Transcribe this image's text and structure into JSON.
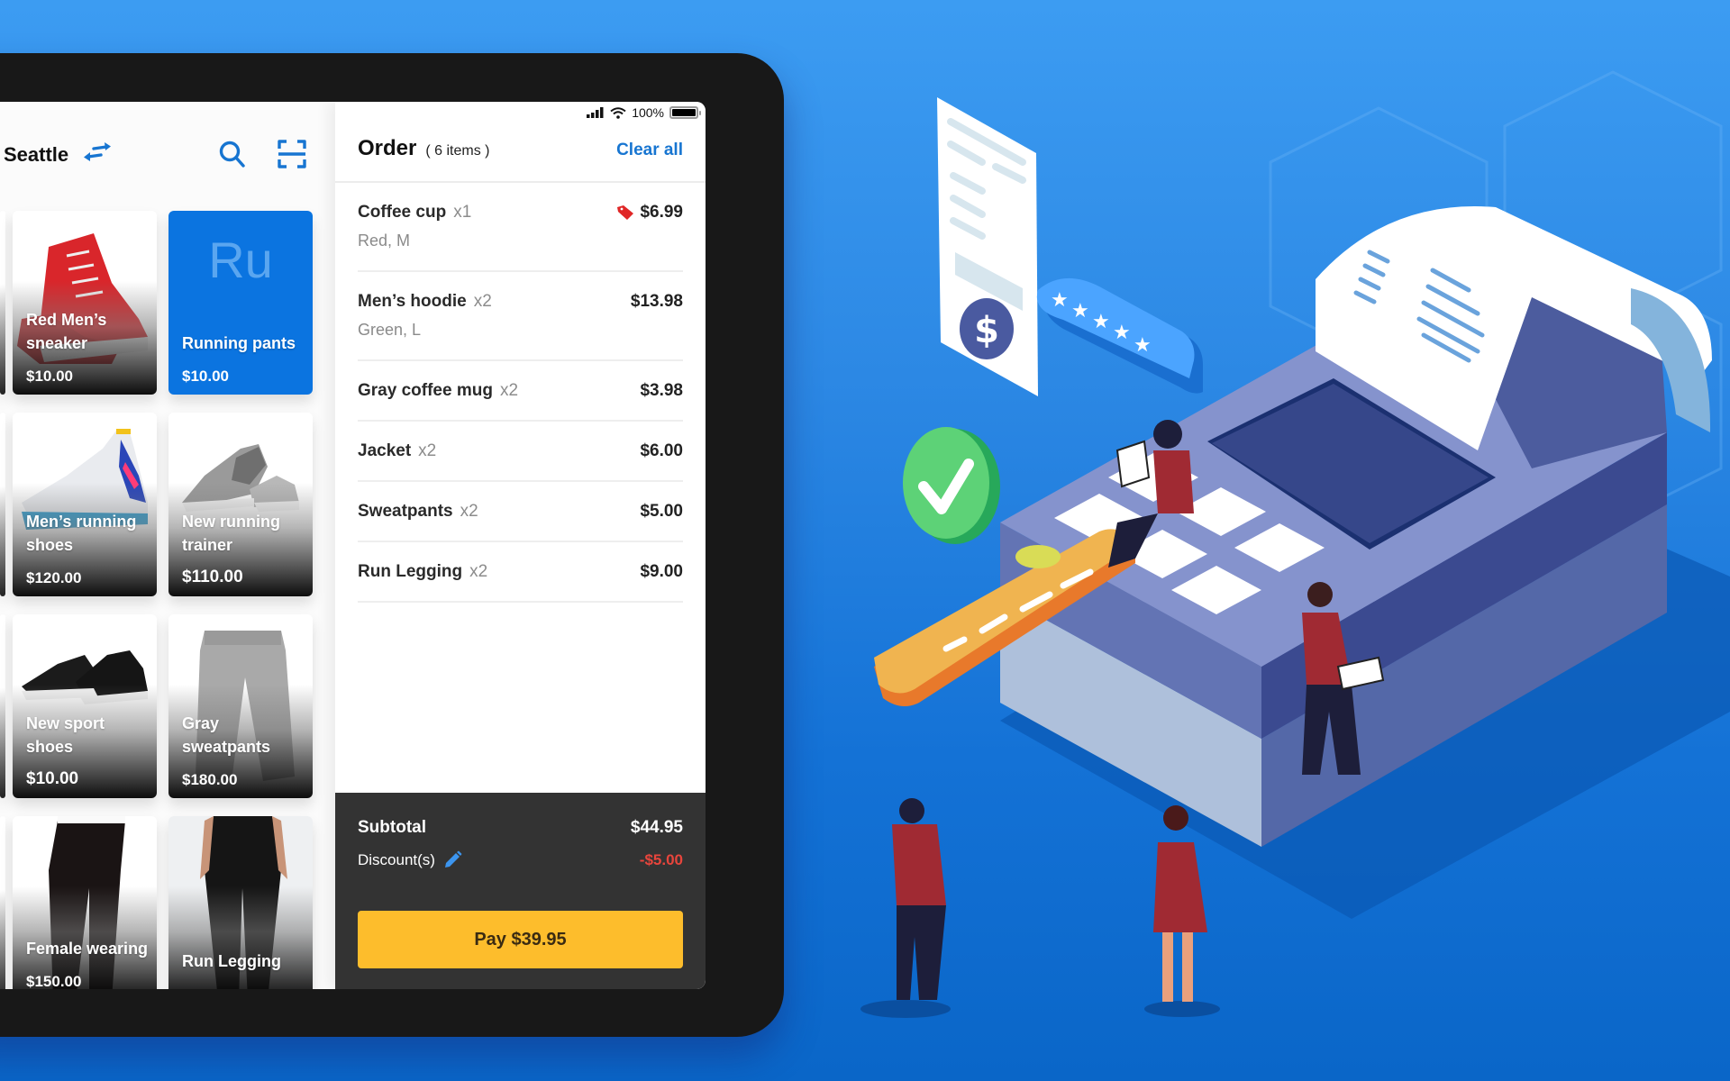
{
  "status_bar": {
    "battery": "100%",
    "battery_level": 1.0
  },
  "catalog": {
    "location": "Seattle",
    "icons": {
      "switch": "swap-arrows-icon",
      "search": "search-icon",
      "scan": "barcode-scan-icon"
    },
    "products": [
      {
        "name": "Red Men’s sneaker",
        "price": "$10.00",
        "image": "red-hightop-sneaker"
      },
      {
        "name": "Running pants",
        "price": "$10.00",
        "initials": "Ru",
        "tile_color": "#0b74e0"
      },
      {
        "name": "Men’s running shoes",
        "price": "$120.00",
        "image": "white-running-shoe"
      },
      {
        "name": "New running trainer",
        "price": "$110.00",
        "image": "gray-trainers"
      },
      {
        "name": "New sport shoes",
        "price": "$10.00",
        "image": "black-sport-shoes"
      },
      {
        "name": "Gray sweatpants",
        "price": "$180.00",
        "image": "gray-sweatpants"
      },
      {
        "name": "Female wearing",
        "price": "$150.00",
        "image": "black-leggings"
      },
      {
        "name": "Run Legging",
        "price": "",
        "image": "black-run-legging"
      }
    ]
  },
  "order": {
    "title": "Order",
    "count": "( 6 items )",
    "clear_label": "Clear all",
    "items": [
      {
        "name": "Coffee cup",
        "qty": "x1",
        "variant": "Red, M",
        "amount": "$6.99",
        "discount_tag": true
      },
      {
        "name": "Men’s hoodie",
        "qty": "x2",
        "variant": "Green, L",
        "amount": "$13.98"
      },
      {
        "name": "Gray coffee mug",
        "qty": "x2",
        "variant": "",
        "amount": "$3.98"
      },
      {
        "name": "Jacket",
        "qty": "x2",
        "variant": "",
        "amount": "$6.00"
      },
      {
        "name": "Sweatpants",
        "qty": "x2",
        "variant": "",
        "amount": "$5.00"
      },
      {
        "name": "Run Legging",
        "qty": "x2",
        "variant": "",
        "amount": "$9.00"
      }
    ],
    "subtotal_label": "Subtotal",
    "subtotal": "$44.95",
    "discount_label": "Discount(s)",
    "discount": "-$5.00",
    "pay_label": "Pay $39.95"
  },
  "colors": {
    "accent": "#1775d1",
    "pay_button": "#fdbd2c",
    "discount": "#e8453c",
    "footer": "#333333",
    "tablet_frame": "#181818"
  },
  "illustration": {
    "elements": [
      "receipt-with-dollar",
      "five-star-rating-bubble",
      "green-checkmark",
      "cash-register",
      "credit-card",
      "people"
    ]
  }
}
